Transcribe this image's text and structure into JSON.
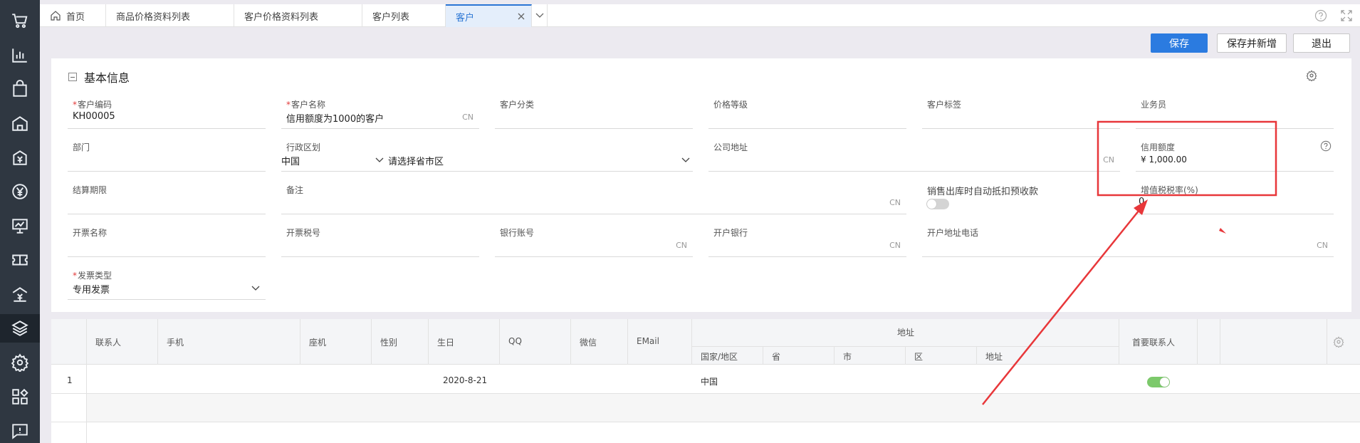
{
  "tabs": [
    {
      "label": "首页"
    },
    {
      "label": "商品价格资料列表"
    },
    {
      "label": "客户价格资料列表"
    },
    {
      "label": "客户列表"
    },
    {
      "label": "客户"
    }
  ],
  "toolbar": {
    "save": "保存",
    "save_new": "保存并新增",
    "exit": "退出"
  },
  "section": {
    "title": "基本信息"
  },
  "form": {
    "code": {
      "label": "客户编码",
      "value": "KH00005"
    },
    "name": {
      "label": "客户名称",
      "value": "信用额度为1000的客户",
      "suffix": "CN"
    },
    "category": {
      "label": "客户分类"
    },
    "price_level": {
      "label": "价格等级"
    },
    "tag": {
      "label": "客户标签"
    },
    "salesman": {
      "label": "业务员"
    },
    "dept": {
      "label": "部门"
    },
    "region": {
      "label": "行政区划",
      "country": "中国",
      "placeholder": "请选择省市区"
    },
    "address": {
      "label": "公司地址",
      "suffix": "CN"
    },
    "credit": {
      "label": "信用额度",
      "value": "¥ 1,000.00"
    },
    "settle": {
      "label": "结算期限"
    },
    "remark": {
      "label": "备注",
      "suffix": "CN"
    },
    "auto_offset": {
      "label": "销售出库时自动抵扣预收款"
    },
    "vat": {
      "label": "增值税税率(%)",
      "value": "0"
    },
    "invoice_name": {
      "label": "开票名称"
    },
    "tax_no": {
      "label": "开票税号"
    },
    "bank_acct": {
      "label": "银行账号",
      "suffix": "CN"
    },
    "bank": {
      "label": "开户银行",
      "suffix": "CN"
    },
    "inv_addr": {
      "label": "开户地址电话",
      "suffix": "CN"
    },
    "invoice_type": {
      "label": "发票类型",
      "value": "专用发票"
    }
  },
  "table": {
    "headers": {
      "contact": "联系人",
      "phone": "手机",
      "tel": "座机",
      "gender": "性别",
      "birthday": "生日",
      "qq": "QQ",
      "wechat": "微信",
      "email": "EMail",
      "address": "地址",
      "country": "国家/地区",
      "province": "省",
      "city": "市",
      "district": "区",
      "addr": "地址",
      "primary": "首要联系人"
    },
    "rows": [
      {
        "no": "1",
        "birthday": "2020-8-21",
        "country": "中国",
        "primary": true
      }
    ]
  },
  "colors": {
    "primary": "#2b7be0",
    "annotation": "#e8373a",
    "sidebar": "#2f3741"
  }
}
